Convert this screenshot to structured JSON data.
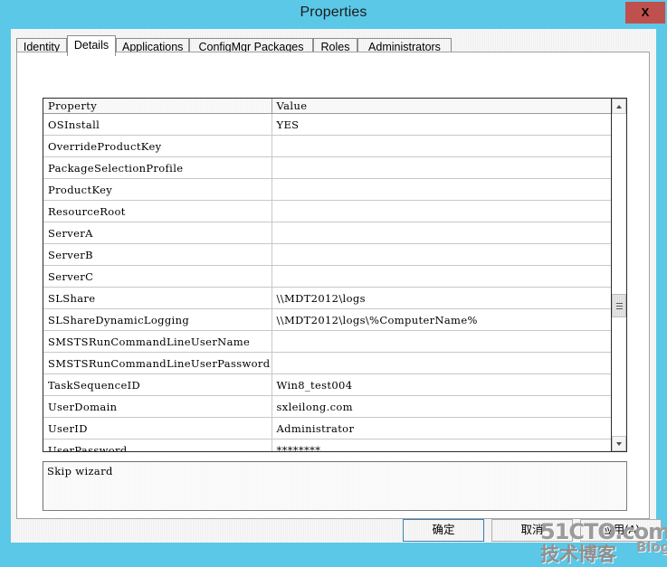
{
  "window": {
    "title": "Properties",
    "close_label": "X",
    "accent_color": "#5bc8e8",
    "close_color": "#c0504d"
  },
  "tabs": [
    {
      "label": "Identity",
      "selected": false
    },
    {
      "label": "Details",
      "selected": true
    },
    {
      "label": "Applications",
      "selected": false
    },
    {
      "label": "ConfigMgr Packages",
      "selected": false
    },
    {
      "label": "Roles",
      "selected": false
    },
    {
      "label": "Administrators",
      "selected": false
    }
  ],
  "grid": {
    "columns": [
      "Property",
      "Value"
    ],
    "rows": [
      {
        "property": "OSInstall",
        "value": "YES"
      },
      {
        "property": "OverrideProductKey",
        "value": ""
      },
      {
        "property": "PackageSelectionProfile",
        "value": ""
      },
      {
        "property": "ProductKey",
        "value": ""
      },
      {
        "property": "ResourceRoot",
        "value": ""
      },
      {
        "property": "ServerA",
        "value": ""
      },
      {
        "property": "ServerB",
        "value": ""
      },
      {
        "property": "ServerC",
        "value": ""
      },
      {
        "property": "SLShare",
        "value": "\\\\MDT2012\\logs"
      },
      {
        "property": "SLShareDynamicLogging",
        "value": "\\\\MDT2012\\logs\\%ComputerName%"
      },
      {
        "property": "SMSTSRunCommandLineUserName",
        "value": ""
      },
      {
        "property": "SMSTSRunCommandLineUserPassword",
        "value": ""
      },
      {
        "property": "TaskSequenceID",
        "value": "Win8_test004"
      },
      {
        "property": "UserDomain",
        "value": "sxleilong.com"
      },
      {
        "property": "UserID",
        "value": "Administrator"
      },
      {
        "property": "UserPassword",
        "value": "********"
      }
    ]
  },
  "description": {
    "text": "Skip wizard"
  },
  "buttons": {
    "ok": "确定",
    "cancel": "取消",
    "apply": "应用(A)"
  },
  "watermark": {
    "top": "51CTO.com",
    "bottom": "技术博客",
    "blog": "Blog"
  }
}
